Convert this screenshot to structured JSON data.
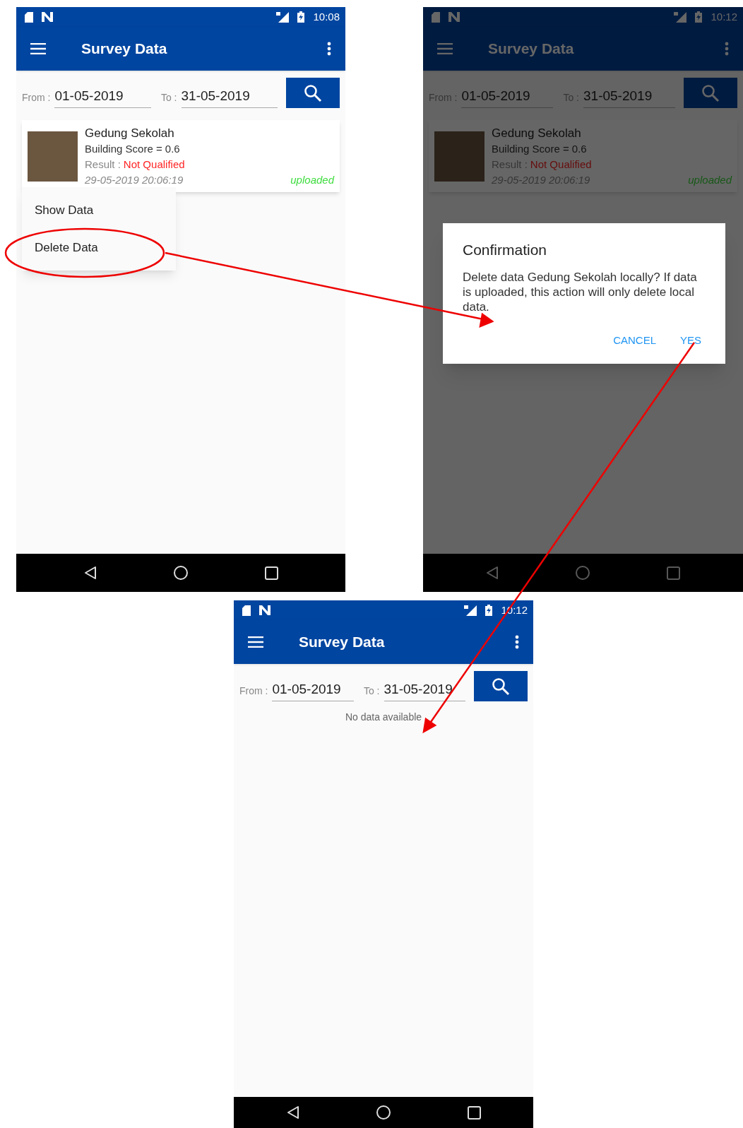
{
  "screens": [
    {
      "status_time": "10:08",
      "title": "Survey Data",
      "from_label": "From :",
      "from_value": "01-05-2019",
      "to_label": "To :",
      "to_value": "31-05-2019",
      "dimmed": false,
      "records": [
        {
          "title": "Gedung Sekolah",
          "score": "Building Score = 0.6",
          "result_label": "Result :",
          "result_value": "Not Qualified",
          "datetime": "29-05-2019 20:06:19",
          "status": "uploaded"
        }
      ],
      "context_menu": [
        "Show Data",
        "Delete Data"
      ]
    },
    {
      "status_time": "10:12",
      "title": "Survey Data",
      "from_label": "From :",
      "from_value": "01-05-2019",
      "to_label": "To :",
      "to_value": "31-05-2019",
      "dimmed": true,
      "records": [
        {
          "title": "Gedung Sekolah",
          "score": "Building Score = 0.6",
          "result_label": "Result :",
          "result_value": "Not Qualified",
          "datetime": "29-05-2019 20:06:19",
          "status": "uploaded"
        }
      ],
      "dialog": {
        "title": "Confirmation",
        "message": "Delete data Gedung Sekolah locally? If data is uploaded, this action will only delete local data.",
        "buttons": [
          "CANCEL",
          "YES"
        ]
      }
    },
    {
      "status_time": "10:12",
      "title": "Survey Data",
      "from_label": "From :",
      "from_value": "01-05-2019",
      "to_label": "To :",
      "to_value": "31-05-2019",
      "dimmed": false,
      "empty_message": "No data available"
    }
  ]
}
